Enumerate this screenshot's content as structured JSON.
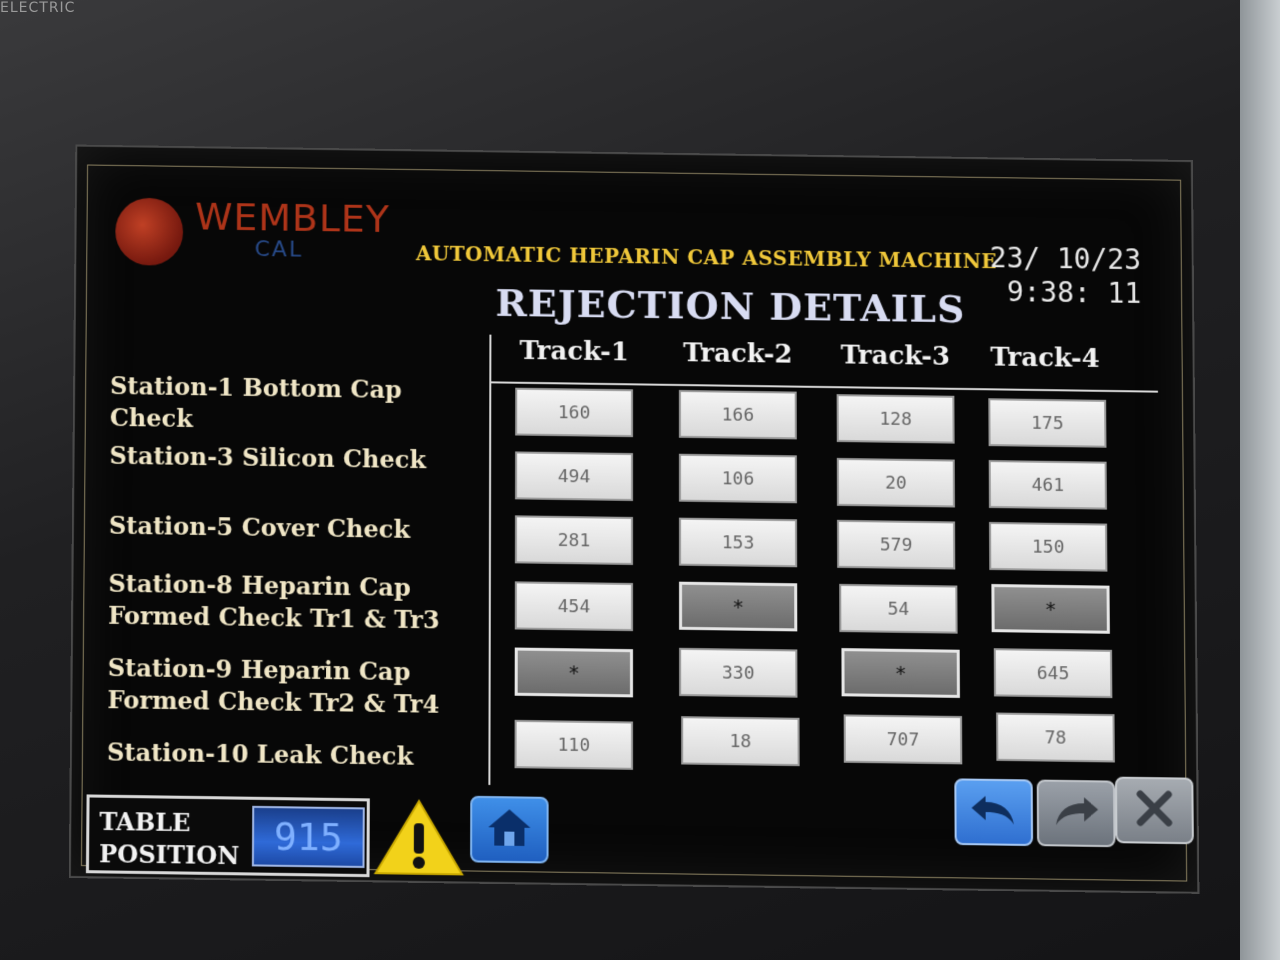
{
  "bezel": {
    "brand_text": "ELECTRIC"
  },
  "header": {
    "logo_text": "WEMBLEY",
    "logo_subtext": "CAL",
    "machine_title": "AUTOMATIC HEPARIN CAP ASSEMBLY MACHINE",
    "date": "23/ 10/23",
    "time": "9:38: 11"
  },
  "page": {
    "title": "REJECTION DETAILS"
  },
  "tracks": [
    "Track-1",
    "Track-2",
    "Track-3",
    "Track-4"
  ],
  "stations": [
    {
      "label_line1": "Station-1 Bottom Cap Check",
      "label_line2": "",
      "values": [
        "160",
        "166",
        "128",
        "175"
      ]
    },
    {
      "label_line1": "Station-3 Silicon Check",
      "label_line2": "",
      "values": [
        "494",
        "106",
        "20",
        "461"
      ]
    },
    {
      "label_line1": "Station-5 Cover Check",
      "label_line2": "",
      "values": [
        "281",
        "153",
        "579",
        "150"
      ]
    },
    {
      "label_line1": "Station-8 Heparin Cap",
      "label_line2": "Formed Check Tr1 & Tr3",
      "values": [
        "454",
        "*",
        "54",
        "*"
      ]
    },
    {
      "label_line1": "Station-9 Heparin Cap",
      "label_line2": "Formed Check Tr2 & Tr4",
      "values": [
        "*",
        "330",
        "*",
        "645"
      ]
    },
    {
      "label_line1": "Station-10 Leak Check",
      "label_line2": "",
      "values": [
        "110",
        "18",
        "707",
        "78"
      ]
    }
  ],
  "footer": {
    "table_position_label_line1": "TABLE",
    "table_position_label_line2": "POSITION",
    "table_position_value": "915",
    "warning_icon": "warning-icon",
    "home_icon": "home-icon",
    "back_icon": "undo-arrow-icon",
    "forward_icon": "redo-arrow-icon",
    "close_icon": "close-icon"
  },
  "colors": {
    "title_gold": "#f0c83a",
    "station_label": "#f0e6c6",
    "button_blue": "#2f6fd0",
    "warning_yellow": "#f2d21a"
  }
}
